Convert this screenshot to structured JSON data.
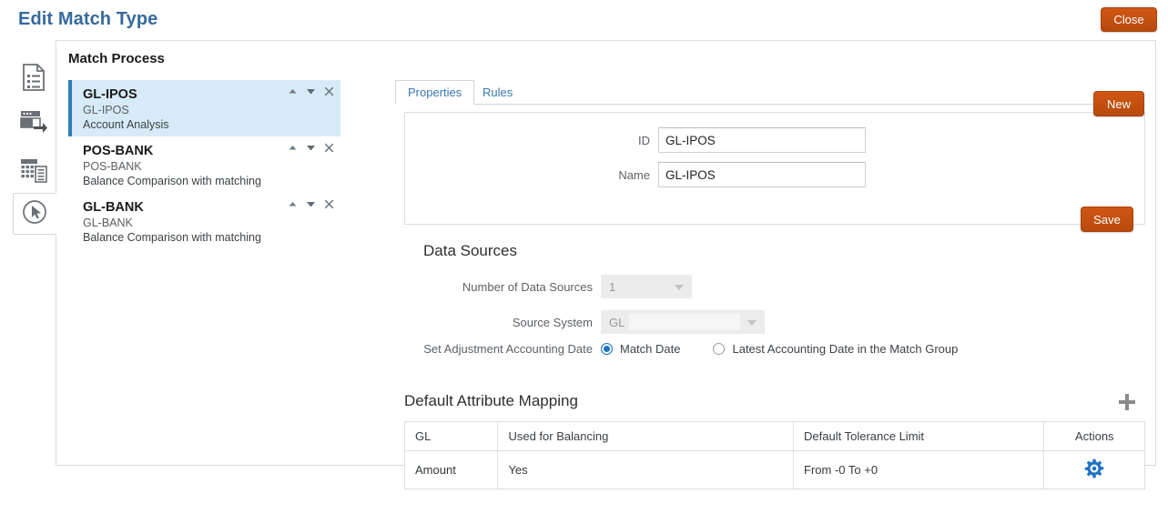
{
  "header": {
    "title": "Edit Match Type",
    "close_label": "Close"
  },
  "panel": {
    "title": "Match Process",
    "new_label": "New"
  },
  "rail": {
    "items": [
      {
        "icon": "document-list-icon",
        "active": false
      },
      {
        "icon": "window-export-icon",
        "active": false
      },
      {
        "icon": "grid-report-icon",
        "active": false
      },
      {
        "icon": "cursor-circle-icon",
        "active": true
      }
    ]
  },
  "match_processes": [
    {
      "name": "GL-IPOS",
      "id": "GL-IPOS",
      "description": "Account Analysis",
      "selected": true
    },
    {
      "name": "POS-BANK",
      "id": "POS-BANK",
      "description": "Balance Comparison with matching",
      "selected": false
    },
    {
      "name": "GL-BANK",
      "id": "GL-BANK",
      "description": "Balance Comparison with matching",
      "selected": false
    }
  ],
  "row_actions": {
    "move_up": "▲",
    "move_down": "▼",
    "remove": "✕"
  },
  "tabs": [
    {
      "label": "Properties",
      "active": true
    },
    {
      "label": "Rules",
      "active": false
    }
  ],
  "properties": {
    "save_label": "Save",
    "id_label": "ID",
    "id_value": "GL-IPOS",
    "name_label": "Name",
    "name_value": "GL-IPOS",
    "data_sources_heading": "Data Sources",
    "number_of_data_sources_label": "Number of Data Sources",
    "number_of_data_sources_value": "1",
    "source_system_label": "Source System",
    "source_system_value": "GL",
    "set_adjustment_label": "Set Adjustment Accounting Date",
    "radio_match_date": "Match Date",
    "radio_latest_date": "Latest Accounting Date in the Match Group"
  },
  "default_attribute_mapping": {
    "heading": "Default Attribute Mapping",
    "add_label": "+",
    "columns": [
      "GL",
      "Used for Balancing",
      "Default Tolerance Limit",
      "Actions"
    ],
    "rows": [
      {
        "gl": "Amount",
        "used_for_balancing": "Yes",
        "default_tolerance_limit": "From -0 To +0",
        "action_icon": "gear-icon"
      }
    ]
  },
  "colors": {
    "accent_orange": "#c44f12",
    "title_blue": "#36699e",
    "selection_blue": "#d7eaf7",
    "selection_bar": "#2c7fb8",
    "radio_blue": "#1c72c4",
    "gear_blue": "#1f72c4"
  }
}
